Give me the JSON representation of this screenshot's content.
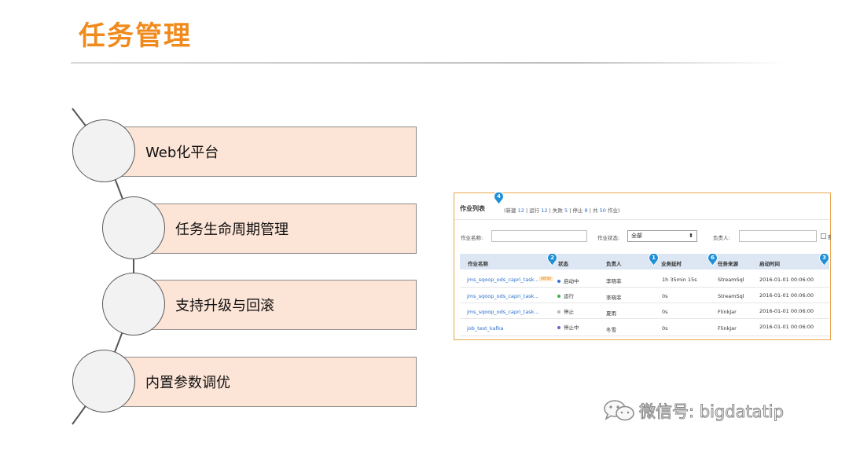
{
  "slide": {
    "title": "任务管理",
    "steps": [
      {
        "label": "Web化平台"
      },
      {
        "label": "任务生命周期管理"
      },
      {
        "label": "支持升级与回滚"
      },
      {
        "label": "内置参数调优"
      }
    ]
  },
  "panel": {
    "title": "作业列表",
    "counts": {
      "open": "(",
      "new_label": "新建",
      "new_count": "12",
      "run_label": "运行",
      "run_count": "12",
      "fail_label": "失败",
      "fail_count": "5",
      "stop_label": "停止",
      "stop_count": "8",
      "total_label": "共",
      "total_count": "50",
      "total_suffix": "作业",
      "close": ")"
    },
    "filters": {
      "name_label": "作业名称:",
      "name_value": "",
      "status_label": "作业状态:",
      "status_value": "全部",
      "owner_label": "负责人:",
      "owner_value": "",
      "checkbox_label": "我"
    },
    "columns": [
      "作业名称",
      "状态",
      "负责人",
      "业务延时",
      "任务来源",
      "启动时间"
    ],
    "rows": [
      {
        "name": "jms_sqoop_ods_capri_task...",
        "tag": "NEW",
        "status": "启动中",
        "status_color": "#3b6fd1",
        "owner": "李晓菲",
        "delay": "1h 35min 15s",
        "source": "StreamSql",
        "start": "2016-01-01 00:06:00"
      },
      {
        "name": "jms_sqoop_ods_capri_task...",
        "tag": "",
        "status": "运行",
        "status_color": "#3cb043",
        "owner": "李晓菲",
        "delay": "0s",
        "source": "StreamSql",
        "start": "2016-01-01 00:06:00"
      },
      {
        "name": "jms_sqoop_ods_capri_task...",
        "tag": "",
        "status": "停止",
        "status_color": "#b5b5b5",
        "owner": "夏雨",
        "delay": "0s",
        "source": "FlinkJar",
        "start": "2016-01-01 00:06:00"
      },
      {
        "name": "job_test_kafka",
        "tag": "",
        "status": "停止中",
        "status_color": "#7a5cc9",
        "owner": "冬雪",
        "delay": "0s",
        "source": "FlinkJar",
        "start": "2016-01-01 00:06:00"
      }
    ],
    "markers": [
      "4",
      "2",
      "1",
      "6",
      "3"
    ]
  },
  "watermark": {
    "text": "微信号: bigdatatip",
    "icon": "wechat-icon"
  },
  "colors": {
    "title": "#f08a1c",
    "step_fill": "#fce4d6",
    "panel_border": "#e8a64e",
    "link": "#2a6fc9",
    "marker": "#1e8fd6"
  }
}
